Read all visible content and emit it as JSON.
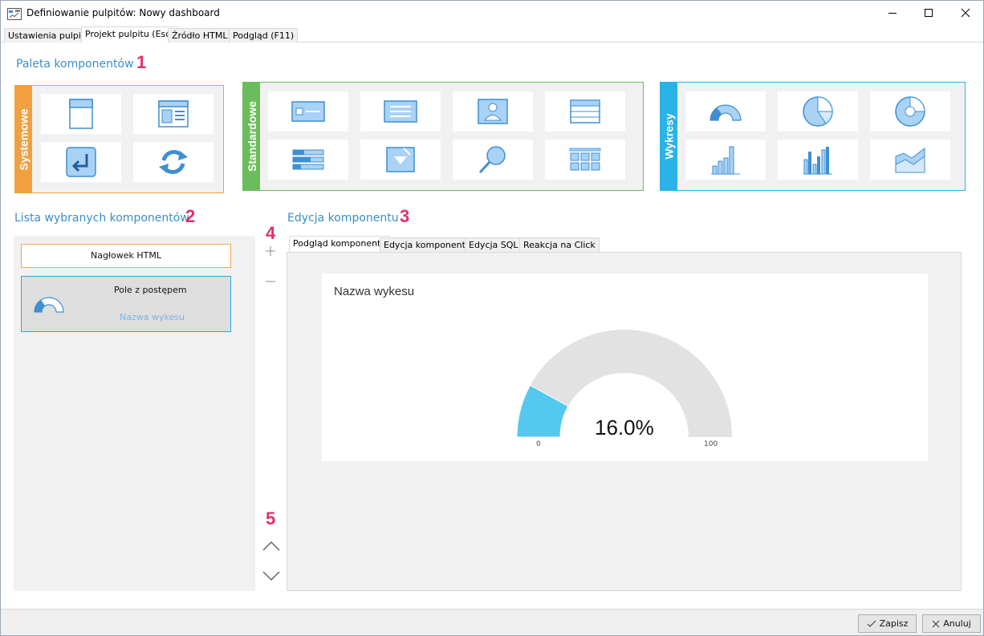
{
  "window": {
    "title": "Definiowanie pulpitów: Nowy dashboard"
  },
  "top_tabs": [
    "Ustawienia pulpitu",
    "Projekt pulpitu (Esc)",
    "Źródło HTML",
    "Podgląd (F11)"
  ],
  "palette": {
    "title": "Paleta komponentów",
    "number": "1",
    "groups": [
      {
        "label": "Systemowe",
        "color": "#f0a040"
      },
      {
        "label": "Standardowe",
        "color": "#6bbd5b"
      },
      {
        "label": "Wykresy",
        "color": "#2ab3e6"
      }
    ]
  },
  "list": {
    "title": "Lista wybranych komponentów",
    "number": "2",
    "items": [
      {
        "title": "Nagłowek HTML"
      },
      {
        "title": "Pole z postępem",
        "subtitle": "Nazwa wykesu"
      }
    ]
  },
  "editor": {
    "title": "Edycja komponentu",
    "number": "3",
    "tabs": [
      "Podgląd komponentu",
      "Edycja komponentu",
      "Edycja SQL",
      "Reakcja na Click"
    ],
    "preview": {
      "card_title": "Nazwa wykesu",
      "value_label": "16.0%",
      "value": 16.0,
      "min_label": "0",
      "max_label": "100",
      "fill_color": "#55c8f0",
      "track_color": "#e2e2e2"
    }
  },
  "side_controls": {
    "number_add": "4",
    "number_move": "5"
  },
  "buttons": {
    "save": "Zapisz",
    "cancel": "Anuluj"
  },
  "colors": {
    "accent": "#3a8ec9",
    "marker": "#e0306a",
    "icon_fill": "#a9d2f5",
    "icon_stroke": "#3f8fd2"
  }
}
